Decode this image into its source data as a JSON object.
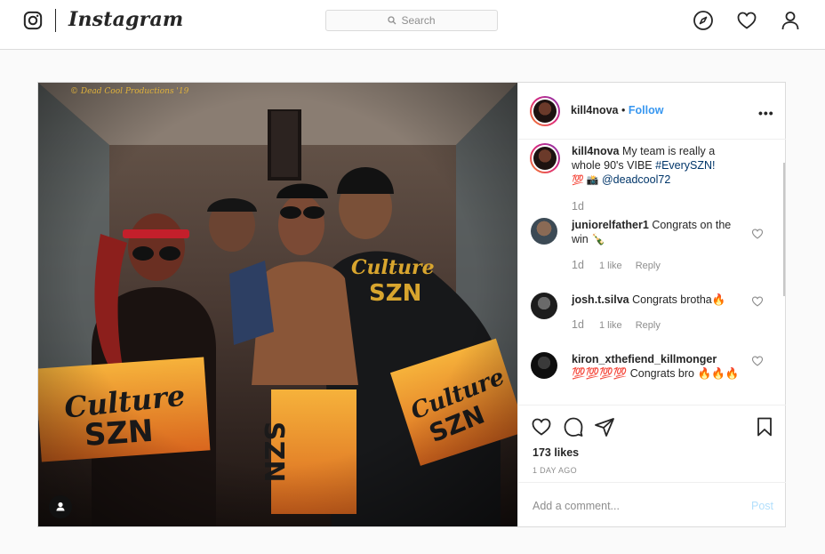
{
  "brand": {
    "wordmark": "Instagram"
  },
  "search": {
    "placeholder": "Search"
  },
  "nav": {
    "icons": [
      "explore-compass-icon",
      "activity-heart-icon",
      "profile-person-icon"
    ]
  },
  "photo": {
    "watermark": "© Dead Cool Productions '19",
    "alt": "Four people posing with a championship belt holding Culture SZN towels",
    "towel_text": "Culture SZN"
  },
  "header": {
    "username": "kill4nova",
    "separator": "•",
    "follow_label": "Follow",
    "more_label": "•••"
  },
  "caption": {
    "username": "kill4nova",
    "text": "My team is really a whole 90's VIBE",
    "hashtag": "#EverySZN!",
    "emoji": "💯 📸",
    "mention": "@deadcool72",
    "age": "1d"
  },
  "comments": [
    {
      "username": "juniorelfather1",
      "text": "Congrats on the win 🍾",
      "age": "1d",
      "likes": "1 like",
      "reply": "Reply"
    },
    {
      "username": "josh.t.silva",
      "text": "Congrats brotha🔥",
      "age": "1d",
      "likes": "1 like",
      "reply": "Reply"
    },
    {
      "username": "kiron_xthefiend_killmonger",
      "text": "💯💯💯💯 Congrats bro 🔥🔥🔥",
      "age": "",
      "likes": "",
      "reply": ""
    }
  ],
  "actions": {
    "likes": "173 likes",
    "time": "1 DAY AGO"
  },
  "composer": {
    "placeholder": "Add a comment...",
    "post_label": "Post"
  },
  "colors": {
    "link": "#3897f0",
    "muted": "#8e8e8e",
    "border": "#dbdbdb"
  }
}
